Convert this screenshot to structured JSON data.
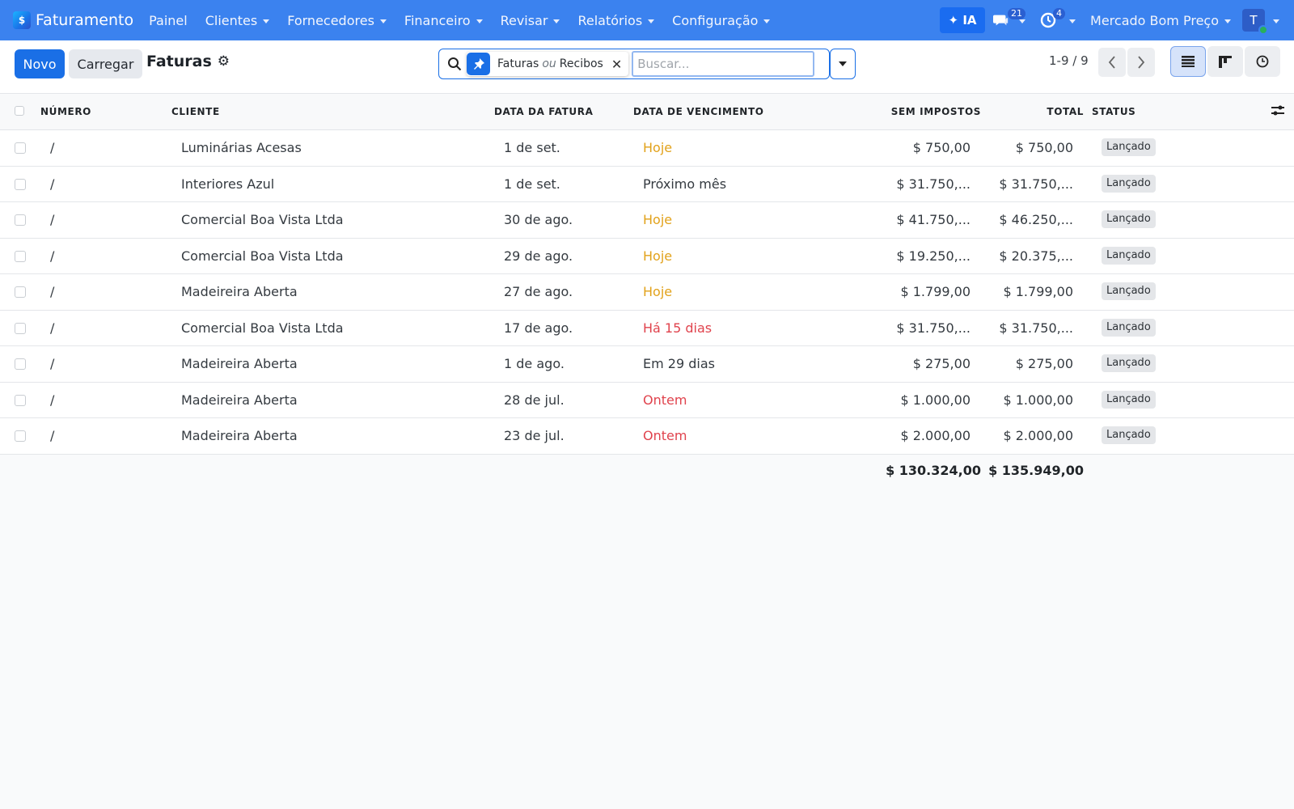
{
  "navbar": {
    "app_name": "Faturamento",
    "menu": [
      {
        "label": "Painel",
        "has_dropdown": false
      },
      {
        "label": "Clientes",
        "has_dropdown": true
      },
      {
        "label": "Fornecedores",
        "has_dropdown": true
      },
      {
        "label": "Financeiro",
        "has_dropdown": true
      },
      {
        "label": "Revisar",
        "has_dropdown": true
      },
      {
        "label": "Relatórios",
        "has_dropdown": true
      },
      {
        "label": "Configuração",
        "has_dropdown": true
      }
    ],
    "ai_label": "✦ IA",
    "messages_count": "21",
    "activities_count": "4",
    "company": "Mercado Bom Preço",
    "avatar_initial": "T"
  },
  "control_panel": {
    "new_label": "Novo",
    "load_label": "Carregar",
    "title": "Faturas",
    "facet": {
      "value1": "Faturas",
      "separator": "ou",
      "value2": "Recibos"
    },
    "search_placeholder": "Buscar...",
    "pager": "1-9 / 9"
  },
  "table": {
    "headers": {
      "number": "NÚMERO",
      "customer": "CLIENTE",
      "invoice_date": "DATA DA FATURA",
      "due_date": "DATA DE VENCIMENTO",
      "untaxed": "SEM IMPOSTOS",
      "total": "TOTAL",
      "status": "STATUS"
    },
    "rows": [
      {
        "number": "/",
        "customer": "Luminárias Acesas",
        "invoice_date": "1 de set.",
        "due_date": "Hoje",
        "due_state": "warning",
        "untaxed": "$ 750,00",
        "total": "$ 750,00",
        "status": "Lançado"
      },
      {
        "number": "/",
        "customer": "Interiores Azul",
        "invoice_date": "1 de set.",
        "due_date": "Próximo mês",
        "due_state": "normal",
        "untaxed": "$ 31.750,...",
        "total": "$ 31.750,...",
        "status": "Lançado"
      },
      {
        "number": "/",
        "customer": "Comercial Boa Vista Ltda",
        "invoice_date": "30 de ago.",
        "due_date": "Hoje",
        "due_state": "warning",
        "untaxed": "$ 41.750,...",
        "total": "$ 46.250,...",
        "status": "Lançado"
      },
      {
        "number": "/",
        "customer": "Comercial Boa Vista Ltda",
        "invoice_date": "29 de ago.",
        "due_date": "Hoje",
        "due_state": "warning",
        "untaxed": "$ 19.250,...",
        "total": "$ 20.375,...",
        "status": "Lançado"
      },
      {
        "number": "/",
        "customer": "Madeireira Aberta",
        "invoice_date": "27 de ago.",
        "due_date": "Hoje",
        "due_state": "warning",
        "untaxed": "$ 1.799,00",
        "total": "$ 1.799,00",
        "status": "Lançado"
      },
      {
        "number": "/",
        "customer": "Comercial Boa Vista Ltda",
        "invoice_date": "17 de ago.",
        "due_date": "Há 15 dias",
        "due_state": "danger",
        "untaxed": "$ 31.750,...",
        "total": "$ 31.750,...",
        "status": "Lançado"
      },
      {
        "number": "/",
        "customer": "Madeireira Aberta",
        "invoice_date": "1 de ago.",
        "due_date": "Em 29 dias",
        "due_state": "normal",
        "untaxed": "$ 275,00",
        "total": "$ 275,00",
        "status": "Lançado"
      },
      {
        "number": "/",
        "customer": "Madeireira Aberta",
        "invoice_date": "28 de jul.",
        "due_date": "Ontem",
        "due_state": "danger",
        "untaxed": "$ 1.000,00",
        "total": "$ 1.000,00",
        "status": "Lançado"
      },
      {
        "number": "/",
        "customer": "Madeireira Aberta",
        "invoice_date": "23 de jul.",
        "due_date": "Ontem",
        "due_state": "danger",
        "untaxed": "$ 2.000,00",
        "total": "$ 2.000,00",
        "status": "Lançado"
      }
    ],
    "totals": {
      "untaxed": "$ 130.324,00",
      "total": "$ 135.949,00"
    }
  },
  "colors": {
    "brand": "#3b82ef",
    "primary": "#1a6fe6",
    "warning": "#e2a21b",
    "danger": "#e0434d"
  }
}
